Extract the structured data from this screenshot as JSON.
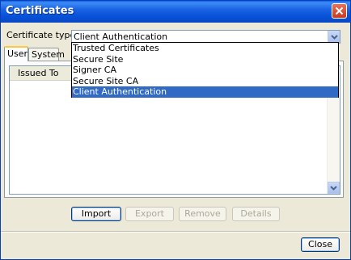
{
  "window": {
    "title": "Certificates"
  },
  "cert_type": {
    "label": "Certificate type:",
    "value": "Client Authentication",
    "options": [
      "Trusted Certificates",
      "Secure Site",
      "Signer CA",
      "Secure Site CA",
      "Client Authentication"
    ],
    "selected_index": 4
  },
  "tabs": [
    {
      "label": "User"
    },
    {
      "label": "System"
    }
  ],
  "table": {
    "columns": [
      {
        "label": "Issued To"
      }
    ]
  },
  "buttons": {
    "import": "Import",
    "export": "Export",
    "remove": "Remove",
    "details": "Details",
    "close": "Close"
  },
  "icons": {
    "close": "close-icon",
    "combo_arrow": "chevron-down-icon",
    "scroll_down": "arrow-down-icon",
    "scroll_up": "arrow-up-icon"
  },
  "colors": {
    "title_bar": "#0a5fe9",
    "selection": "#316ac5",
    "tab_highlight": "#ffc83c"
  }
}
